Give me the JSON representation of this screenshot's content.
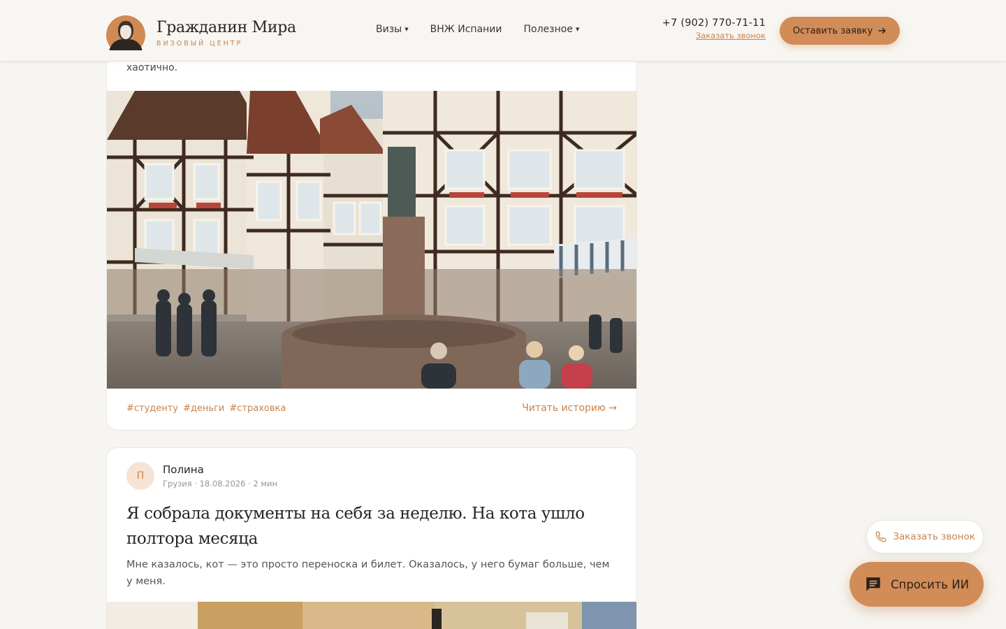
{
  "header": {
    "brand_title": "Гражданин Мира",
    "brand_subtitle": "ВИЗОВЫЙ ЦЕНТР",
    "nav": [
      {
        "label": "Визы",
        "has_dropdown": true
      },
      {
        "label": "ВНЖ Испании",
        "has_dropdown": false
      },
      {
        "label": "Полезное",
        "has_dropdown": true
      }
    ],
    "phone": "+7 (902) 770-71-11",
    "callback_link": "Заказать звонок",
    "cta_label": "Оставить заявку"
  },
  "stories": [
    {
      "excerpt_tail": "хаотично.",
      "image_alt": "half-timbered town square with fountain",
      "tags": [
        "#студенту",
        "#деньги",
        "#страховка"
      ],
      "read_label": "Читать историю"
    },
    {
      "author_initial": "П",
      "author_name": "Полина",
      "meta": "Грузия · 18.08.2026 · 2 мин",
      "title": "Я собрала документы на себя за неделю. На кота ушло полтора месяца",
      "excerpt": "Мне казалось, кот — это просто переноска и билет. Оказалось, у него бумаг больше, чем у меня."
    }
  ],
  "floating": {
    "callback_label": "Заказать звонок",
    "ask_ai_label": "Спросить ИИ"
  },
  "colors": {
    "accent": "#d28c57",
    "accent_text": "#c8834c",
    "background": "#f7f5f1"
  }
}
